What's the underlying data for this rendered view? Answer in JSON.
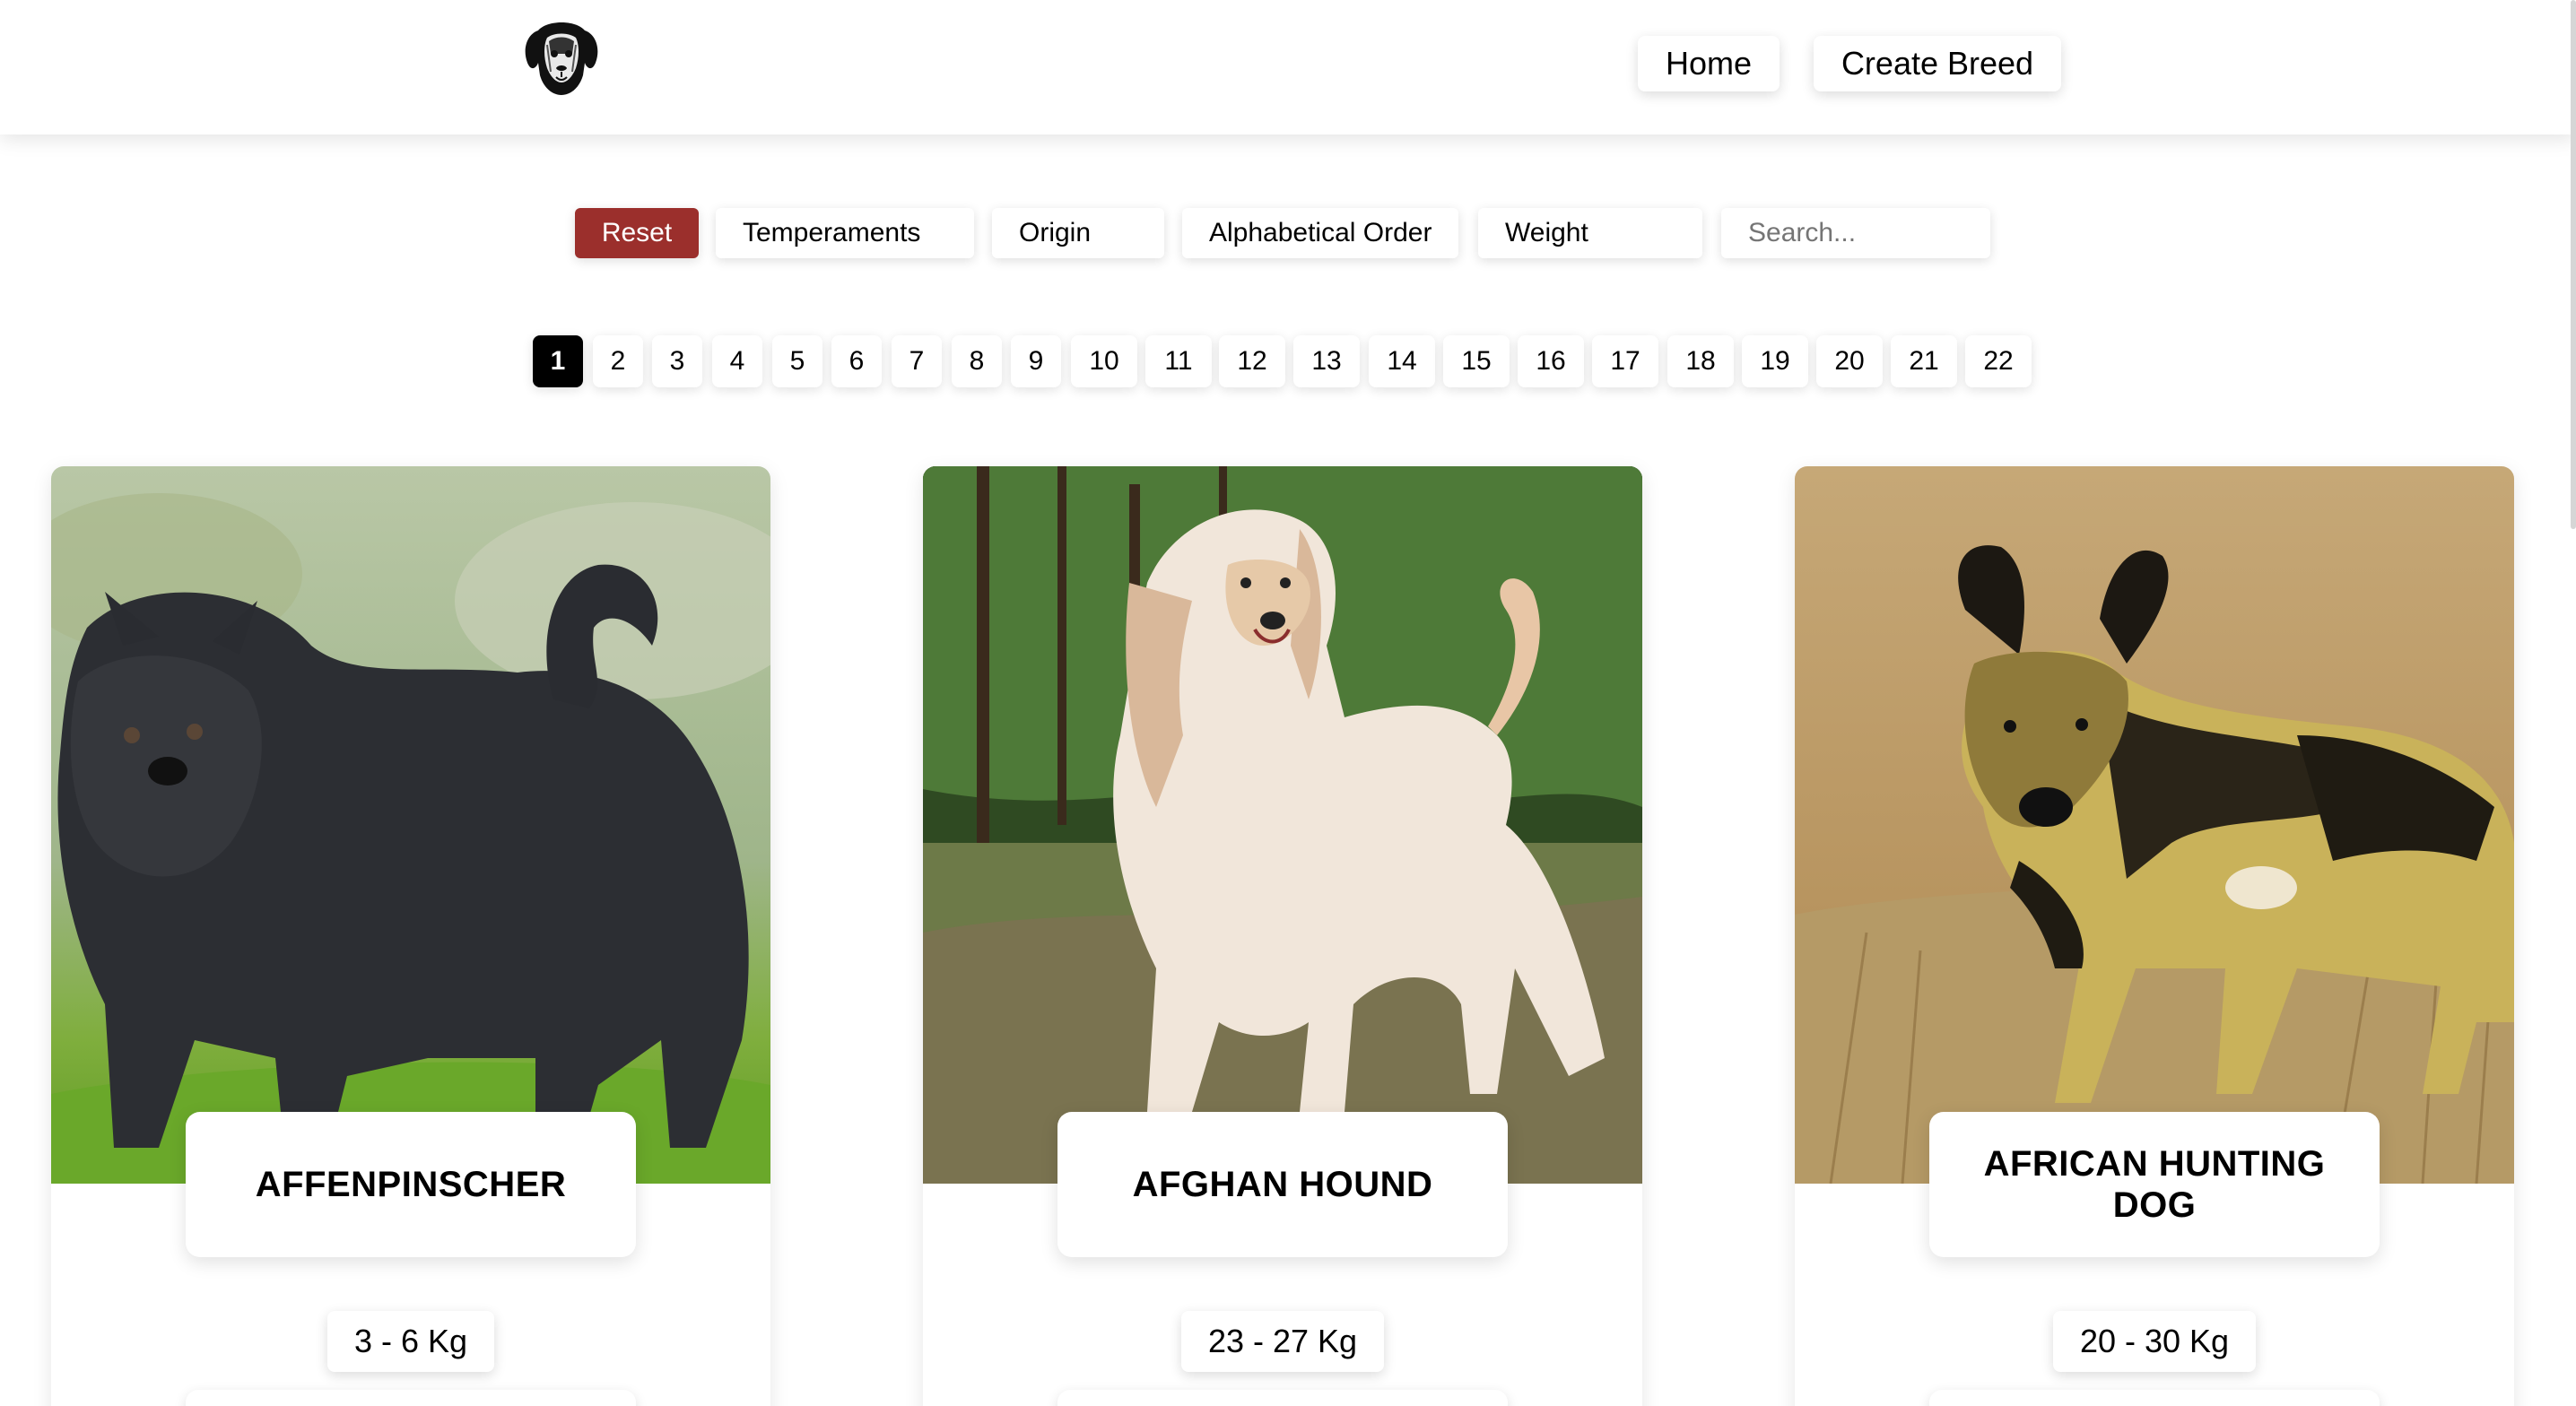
{
  "navbar": {
    "logo_icon": "dog-head-logo-icon",
    "home_label": "Home",
    "create_label": "Create Breed"
  },
  "filters": {
    "reset_label": "Reset",
    "temperaments_label": "Temperaments",
    "origin_label": "Origin",
    "alphabetical_label": "Alphabetical Order",
    "weight_label": "Weight",
    "search_placeholder": "Search...",
    "reset_color": "#9b2f2c"
  },
  "pagination": {
    "current": "1",
    "pages": [
      "1",
      "2",
      "3",
      "4",
      "5",
      "6",
      "7",
      "8",
      "9",
      "10",
      "11",
      "12",
      "13",
      "14",
      "15",
      "16",
      "17",
      "18",
      "19",
      "20",
      "21",
      "22"
    ]
  },
  "cards": [
    {
      "name": "AFFENPINSCHER",
      "weight": "3 - 6 Kg",
      "image": "affenpinscher-photo"
    },
    {
      "name": "AFGHAN HOUND",
      "weight": "23 - 27 Kg",
      "image": "afghan-hound-photo"
    },
    {
      "name": "AFRICAN HUNTING DOG",
      "weight": "20 - 30 Kg",
      "image": "african-hunting-dog-photo"
    }
  ]
}
